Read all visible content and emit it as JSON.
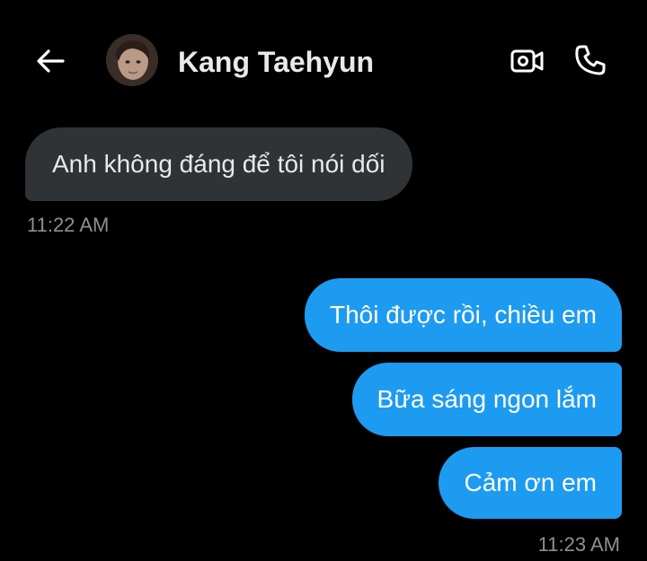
{
  "header": {
    "contact_name": "Kang Taehyun",
    "back_icon": "arrow-left-icon",
    "video_icon": "video-camera-icon",
    "call_icon": "phone-icon"
  },
  "messages": {
    "received": [
      {
        "text": "Anh không đáng để tôi nói dối",
        "time": "11:22 AM"
      }
    ],
    "sent": [
      {
        "text": "Thôi được rồi, chiều em"
      },
      {
        "text": "Bữa sáng ngon lắm"
      },
      {
        "text": "Cảm ơn em"
      }
    ],
    "sent_time": "11:23 AM"
  },
  "colors": {
    "background": "#000000",
    "received_bubble": "#2f3336",
    "sent_bubble": "#1d9bf0",
    "timestamp": "#8b9095",
    "text": "#e7e9ea"
  }
}
